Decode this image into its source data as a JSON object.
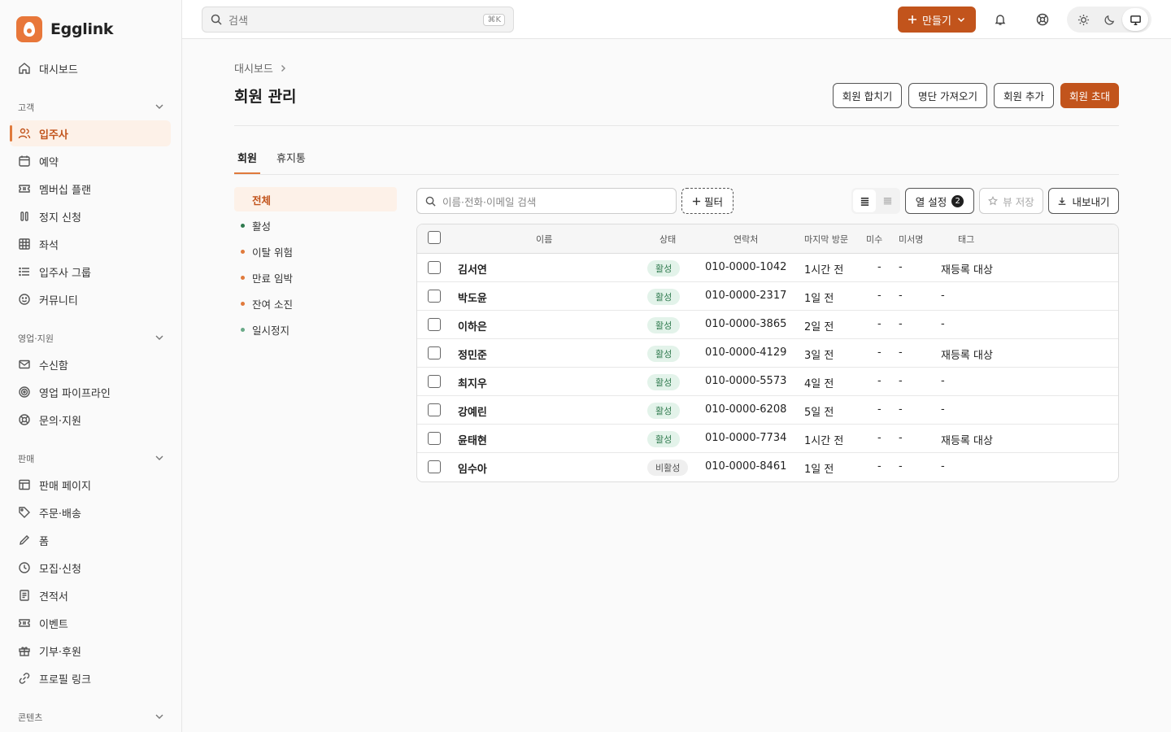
{
  "brand": {
    "name": "Egglink"
  },
  "sidebar": {
    "dashboard": "대시보드",
    "sections": [
      {
        "title": "고객",
        "items": [
          "입주사",
          "예약",
          "멤버십 플랜",
          "정지 신청",
          "좌석",
          "입주사 그룹",
          "커뮤니티"
        ]
      },
      {
        "title": "영업·지원",
        "items": [
          "수신함",
          "영업 파이프라인",
          "문의·지원"
        ]
      },
      {
        "title": "판매",
        "items": [
          "판매 페이지",
          "주문·배송",
          "폼",
          "모집·신청",
          "견적서",
          "이벤트",
          "기부·후원",
          "프로필 링크"
        ]
      },
      {
        "title": "콘텐츠",
        "items": []
      }
    ],
    "active": "입주사"
  },
  "topbar": {
    "search_placeholder": "검색",
    "shortcut": "⌘K",
    "create_label": "만들기"
  },
  "page": {
    "breadcrumb": "대시보드",
    "title": "회원 관리",
    "actions": [
      "회원 합치기",
      "명단 가져오기",
      "회원 추가",
      "회원 초대"
    ]
  },
  "tabs": [
    "회원",
    "휴지통"
  ],
  "segments": [
    {
      "label": "전체",
      "dot": ""
    },
    {
      "label": "활성",
      "dot": "#2f7a4e"
    },
    {
      "label": "이탈 위험",
      "dot": "#e07a3c"
    },
    {
      "label": "만료 임박",
      "dot": "#e07a3c"
    },
    {
      "label": "잔여 소진",
      "dot": "#e07a3c"
    },
    {
      "label": "일시정지",
      "dot": "#6aaa88"
    }
  ],
  "toolbar": {
    "search_placeholder": "이름·전화·이메일 검색",
    "filter_label": "필터",
    "columns_label": "열 설정",
    "columns_count": "2",
    "save_view_label": "뷰 저장",
    "export_label": "내보내기"
  },
  "table": {
    "headers": [
      "이름",
      "상태",
      "연락처",
      "마지막 방문",
      "미수",
      "미서명",
      "태그"
    ],
    "rows": [
      {
        "name": "김서연",
        "status": "활성",
        "phone": "010-0000-1042",
        "last_visit": "1시간 전",
        "unpaid": "-",
        "unsigned": "-",
        "tag": "재등록 대상"
      },
      {
        "name": "박도윤",
        "status": "활성",
        "phone": "010-0000-2317",
        "last_visit": "1일 전",
        "unpaid": "-",
        "unsigned": "-",
        "tag": "-"
      },
      {
        "name": "이하은",
        "status": "활성",
        "phone": "010-0000-3865",
        "last_visit": "2일 전",
        "unpaid": "-",
        "unsigned": "-",
        "tag": "-"
      },
      {
        "name": "정민준",
        "status": "활성",
        "phone": "010-0000-4129",
        "last_visit": "3일 전",
        "unpaid": "-",
        "unsigned": "-",
        "tag": "재등록 대상"
      },
      {
        "name": "최지우",
        "status": "활성",
        "phone": "010-0000-5573",
        "last_visit": "4일 전",
        "unpaid": "-",
        "unsigned": "-",
        "tag": "-"
      },
      {
        "name": "강예린",
        "status": "활성",
        "phone": "010-0000-6208",
        "last_visit": "5일 전",
        "unpaid": "-",
        "unsigned": "-",
        "tag": "-"
      },
      {
        "name": "윤태현",
        "status": "활성",
        "phone": "010-0000-7734",
        "last_visit": "1시간 전",
        "unpaid": "-",
        "unsigned": "-",
        "tag": "재등록 대상"
      },
      {
        "name": "임수아",
        "status": "비활성",
        "phone": "010-0000-8461",
        "last_visit": "1일 전",
        "unpaid": "-",
        "unsigned": "-",
        "tag": "-"
      }
    ]
  },
  "colors": {
    "accent": "#c2541c",
    "accent_light": "#fdf1e8",
    "active_badge_bg": "#e3f3ea",
    "active_badge_text": "#2f7a4e"
  }
}
